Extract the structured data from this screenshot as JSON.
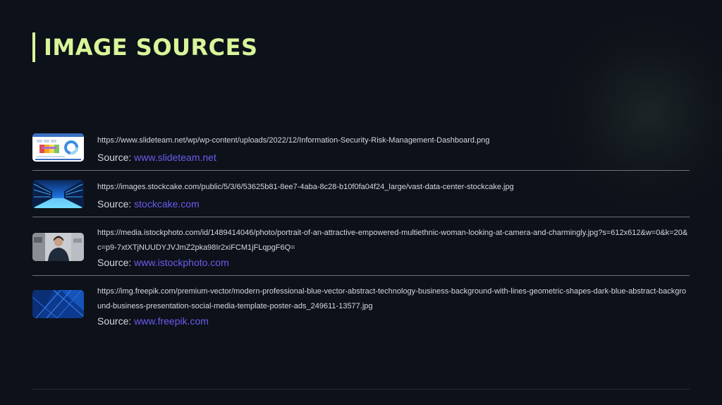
{
  "page": {
    "title": "IMAGE SOURCES",
    "accent_color": "#d9f59a",
    "link_color": "#6b5cf0"
  },
  "entries": [
    {
      "url": "https://www.slideteam.net/wp/wp-content/uploads/2022/12/Information-Security-Risk-Management-Dashboard.png",
      "source_label": "Source:",
      "source_link": "www.slideteam.net",
      "thumb_icon": "dashboard-thumbnail-icon"
    },
    {
      "url": "https://images.stockcake.com/public/5/3/6/53625b81-8ee7-4aba-8c28-b10f0fa04f24_large/vast-data-center-stockcake.jpg",
      "source_label": "Source:",
      "source_link": "stockcake.com",
      "thumb_icon": "data-center-thumbnail-icon"
    },
    {
      "url": "https://media.istockphoto.com/id/1489414046/photo/portrait-of-an-attractive-empowered-multiethnic-woman-looking-at-camera-and-charmingly.jpg?s=612x612&w=0&k=20&c=p9-7xtXTjNUUDYJVJmZ2pka98Ir2xiFCM1jFLqpgF6Q=",
      "source_label": "Source:",
      "source_link": "www.istockphoto.com",
      "thumb_icon": "portrait-thumbnail-icon"
    },
    {
      "url": "https://img.freepik.com/premium-vector/modern-professional-blue-vector-abstract-technology-business-background-with-lines-geometric-shapes-dark-blue-abstract-background-business-presentation-social-media-template-poster-ads_249611-13577.jpg",
      "source_label": "Source:",
      "source_link": "www.freepik.com",
      "thumb_icon": "blue-abstract-thumbnail-icon"
    }
  ]
}
